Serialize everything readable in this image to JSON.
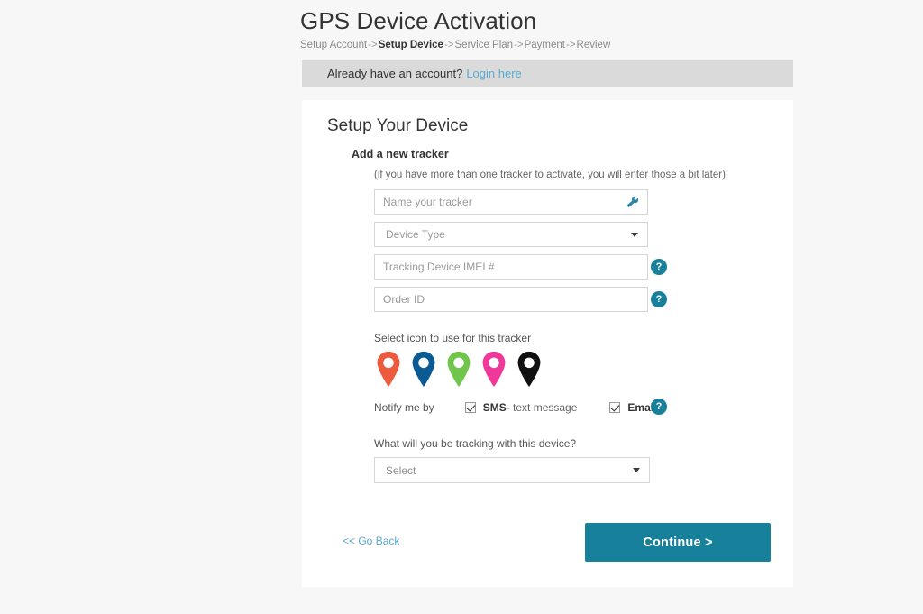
{
  "page": {
    "title": "GPS Device Activation",
    "background_color": "#f7f7f7",
    "card_color": "#ffffff"
  },
  "breadcrumb": {
    "separator": "->",
    "steps": [
      {
        "label": "Setup Account",
        "active": false
      },
      {
        "label": "Setup Device",
        "active": true
      },
      {
        "label": "Service Plan",
        "active": false
      },
      {
        "label": "Payment",
        "active": false
      },
      {
        "label": "Review",
        "active": false
      }
    ]
  },
  "login_alert": {
    "text": "Already have an account?",
    "link_label": "Login here",
    "link_color": "#54aed3",
    "background_color": "#dadada"
  },
  "card": {
    "title": "Setup Your Device",
    "section_heading": "Add a new tracker",
    "section_note": "(if you have more than one tracker to activate, you will enter those a bit later)"
  },
  "fields": {
    "tracker_name": {
      "placeholder": "Name your tracker",
      "value": "",
      "icon": "wrench-icon"
    },
    "device_type": {
      "placeholder": "Device Type",
      "value": "",
      "icon": "chevron-down-icon"
    },
    "imei": {
      "placeholder": "Tracking Device IMEI #",
      "value": "",
      "help": "?"
    },
    "order_id": {
      "placeholder": "Order ID",
      "value": "",
      "help": "?"
    }
  },
  "icon_picker": {
    "label": "Select icon to use for this tracker",
    "pins": [
      {
        "name": "map-pin-orange",
        "color": "#ec5b3e"
      },
      {
        "name": "map-pin-blue",
        "color": "#0a5b94"
      },
      {
        "name": "map-pin-green",
        "color": "#6fc64b"
      },
      {
        "name": "map-pin-pink",
        "color": "#f0389a"
      },
      {
        "name": "map-pin-black",
        "color": "#111111"
      }
    ]
  },
  "notify": {
    "label": "Notify me by",
    "options": [
      {
        "name": "sms",
        "strong": "SMS",
        "rest": " - text message",
        "checked": true
      },
      {
        "name": "email",
        "strong": "Email",
        "rest": "",
        "checked": true
      }
    ],
    "help": "?"
  },
  "tracking": {
    "question": "What will you be tracking with this device?",
    "select_value": "Select"
  },
  "footer": {
    "back_label": "<< Go Back",
    "continue_label": "Continue >",
    "continue_color": "#17809b"
  }
}
